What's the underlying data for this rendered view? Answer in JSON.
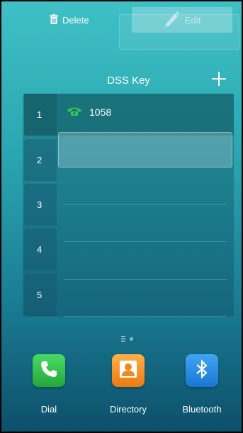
{
  "toolbar": {
    "delete_label": "Delete",
    "edit_label": "Edit"
  },
  "dss": {
    "title": "DSS Key",
    "keys": [
      {
        "index": "1",
        "label": "1058",
        "icon": "phone-icon"
      },
      {
        "index": "2",
        "label": ""
      },
      {
        "index": "3",
        "label": ""
      },
      {
        "index": "4",
        "label": ""
      },
      {
        "index": "5",
        "label": ""
      }
    ]
  },
  "pager": {
    "pages": 2,
    "current": 1
  },
  "dock": [
    {
      "label": "Dial",
      "icon": "phone-icon",
      "color": "#2fbf4a"
    },
    {
      "label": "Directory",
      "icon": "contact-icon",
      "color": "#f08a1c"
    },
    {
      "label": "Bluetooth",
      "icon": "bluetooth-icon",
      "color": "#2196e6"
    }
  ],
  "colors": {
    "accent_green": "#33cc55",
    "background_top": "#3fc0c6",
    "background_bottom": "#0d4f6a"
  }
}
